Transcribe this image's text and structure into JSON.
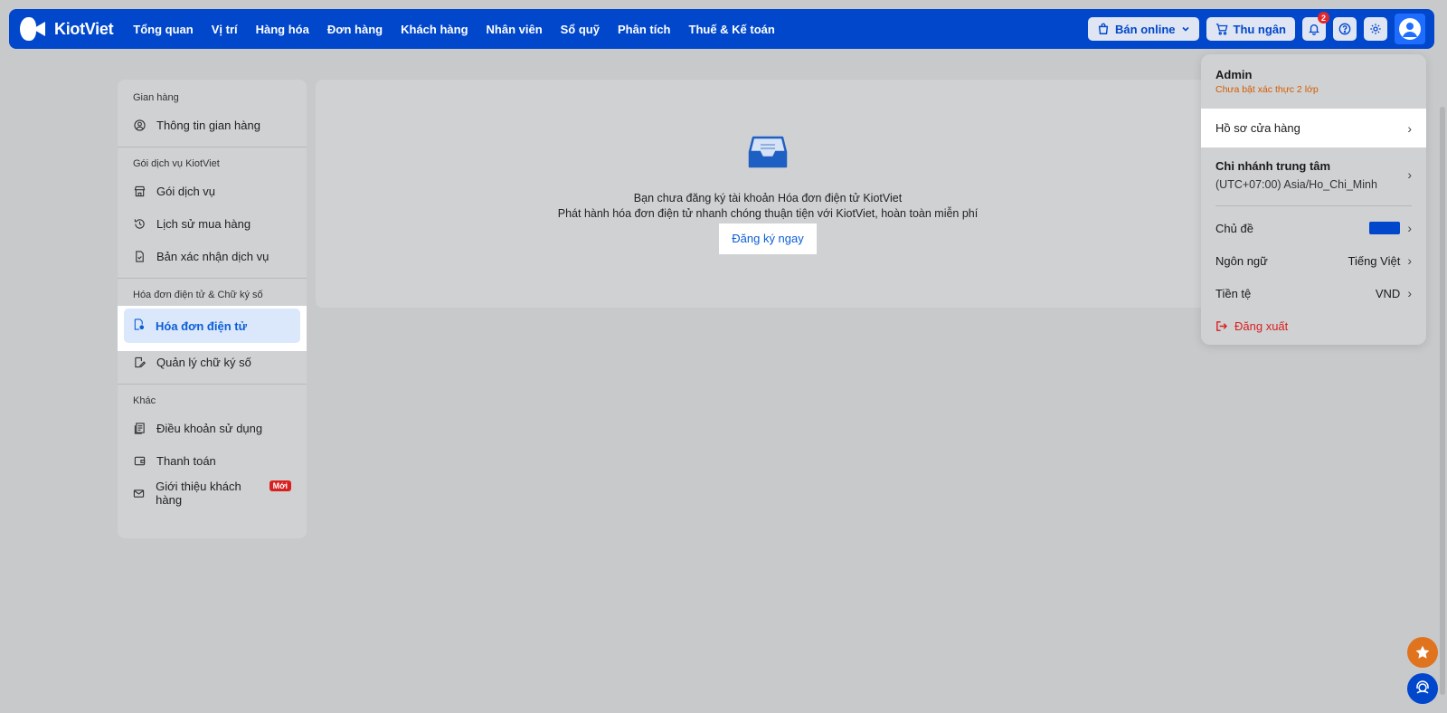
{
  "brand": {
    "name": "KiotViet"
  },
  "nav": [
    "Tổng quan",
    "Vị trí",
    "Hàng hóa",
    "Đơn hàng",
    "Khách hàng",
    "Nhân viên",
    "Sổ quỹ",
    "Phân tích",
    "Thuế & Kế toán"
  ],
  "topbar": {
    "sell_online": "Bán online",
    "cashier": "Thu ngân",
    "notif_count": "2"
  },
  "sidebar": {
    "sections": [
      {
        "title": "Gian hàng",
        "items": [
          {
            "label": "Thông tin gian hàng",
            "icon": "user-circle-icon"
          }
        ]
      },
      {
        "title": "Gói dịch vụ KiotViet",
        "items": [
          {
            "label": "Gói dịch vụ",
            "icon": "store-icon"
          },
          {
            "label": "Lịch sử mua hàng",
            "icon": "history-icon"
          },
          {
            "label": "Bản xác nhận dịch vụ",
            "icon": "document-icon"
          }
        ]
      },
      {
        "title": "Hóa đơn điện tử & Chữ ký số",
        "items": [
          {
            "label": "Hóa đơn điện tử",
            "icon": "invoice-icon",
            "active": true
          },
          {
            "label": "Quản lý chữ ký số",
            "icon": "signature-icon"
          }
        ]
      },
      {
        "title": "Khác",
        "items": [
          {
            "label": "Điều khoản sử dụng",
            "icon": "terms-icon"
          },
          {
            "label": "Thanh toán",
            "icon": "wallet-icon"
          },
          {
            "label": "Giới thiệu khách hàng",
            "icon": "mail-icon",
            "badge": "Mới"
          }
        ]
      }
    ]
  },
  "main": {
    "empty_line1": "Bạn chưa đăng ký tài khoản Hóa đơn điện tử KiotViet",
    "empty_line2": "Phát hành hóa đơn điện tử nhanh chóng thuận tiện với KiotViet, hoàn toàn miễn phí",
    "cta": "Đăng ký ngay"
  },
  "account_menu": {
    "user": "Admin",
    "twofa_notice": "Chưa bật xác thực 2 lớp",
    "store_profile": "Hồ sơ cửa hàng",
    "branch_name": "Chi nhánh trung tâm",
    "branch_tz": "(UTC+07:00) Asia/Ho_Chi_Minh",
    "theme_label": "Chủ đề",
    "theme_color": "#0047cc",
    "language_label": "Ngôn ngữ",
    "language_value": "Tiếng Việt",
    "currency_label": "Tiền tệ",
    "currency_value": "VND",
    "logout": "Đăng xuất"
  },
  "colors": {
    "brand": "#0047cc",
    "accent_orange": "#e0731d",
    "danger": "#d92020"
  }
}
